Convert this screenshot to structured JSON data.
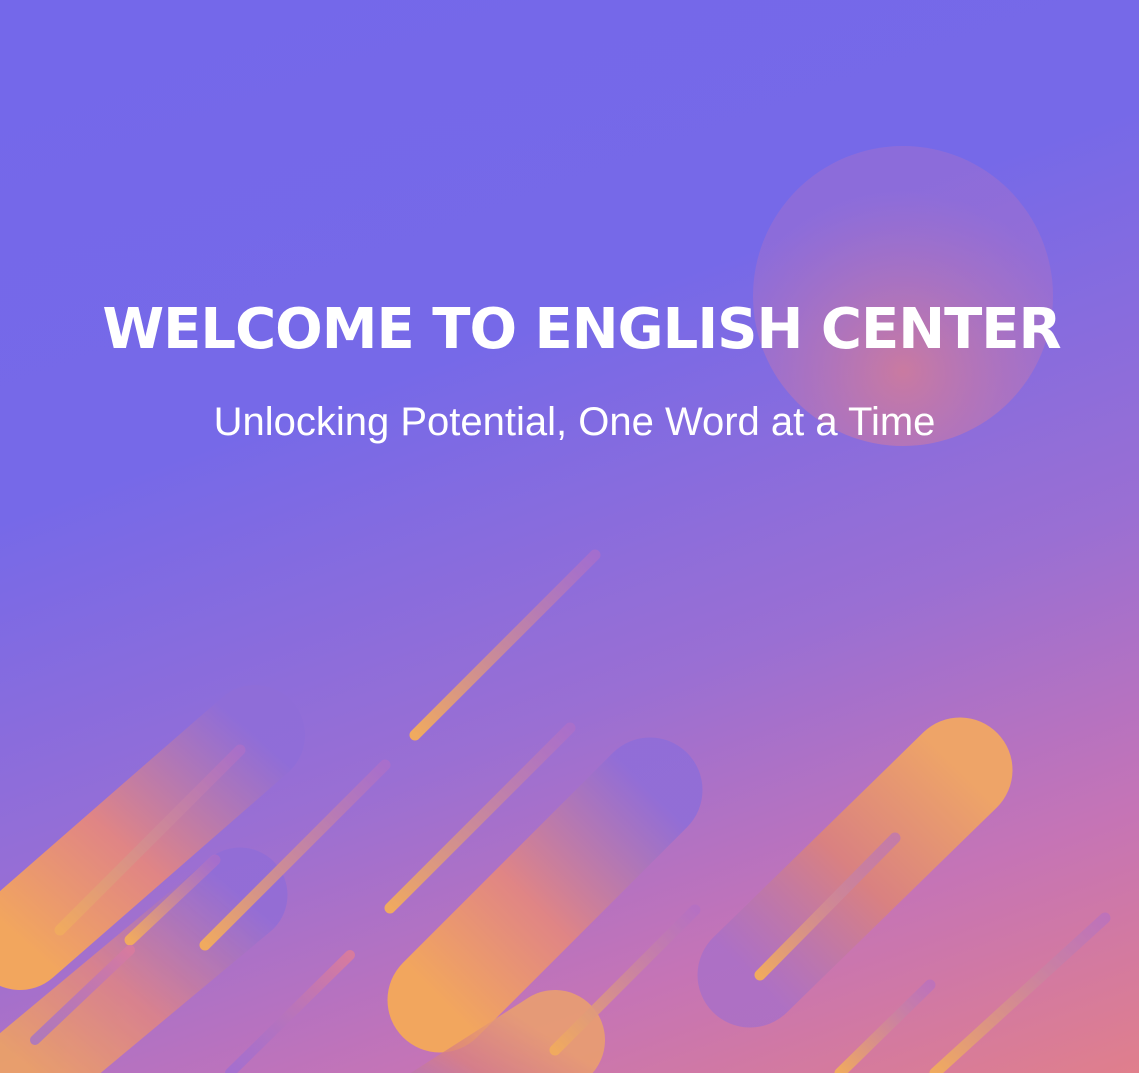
{
  "banner": {
    "title": "WELCOME TO ENGLISH CENTER",
    "subtitle": "Unlocking Potential, One Word at a Time"
  },
  "colors": {
    "background_start": "#7468ea",
    "background_end": "#e07f8c",
    "accent_orange": "#f0a862",
    "accent_pink": "#d97aa4",
    "text": "#ffffff"
  }
}
